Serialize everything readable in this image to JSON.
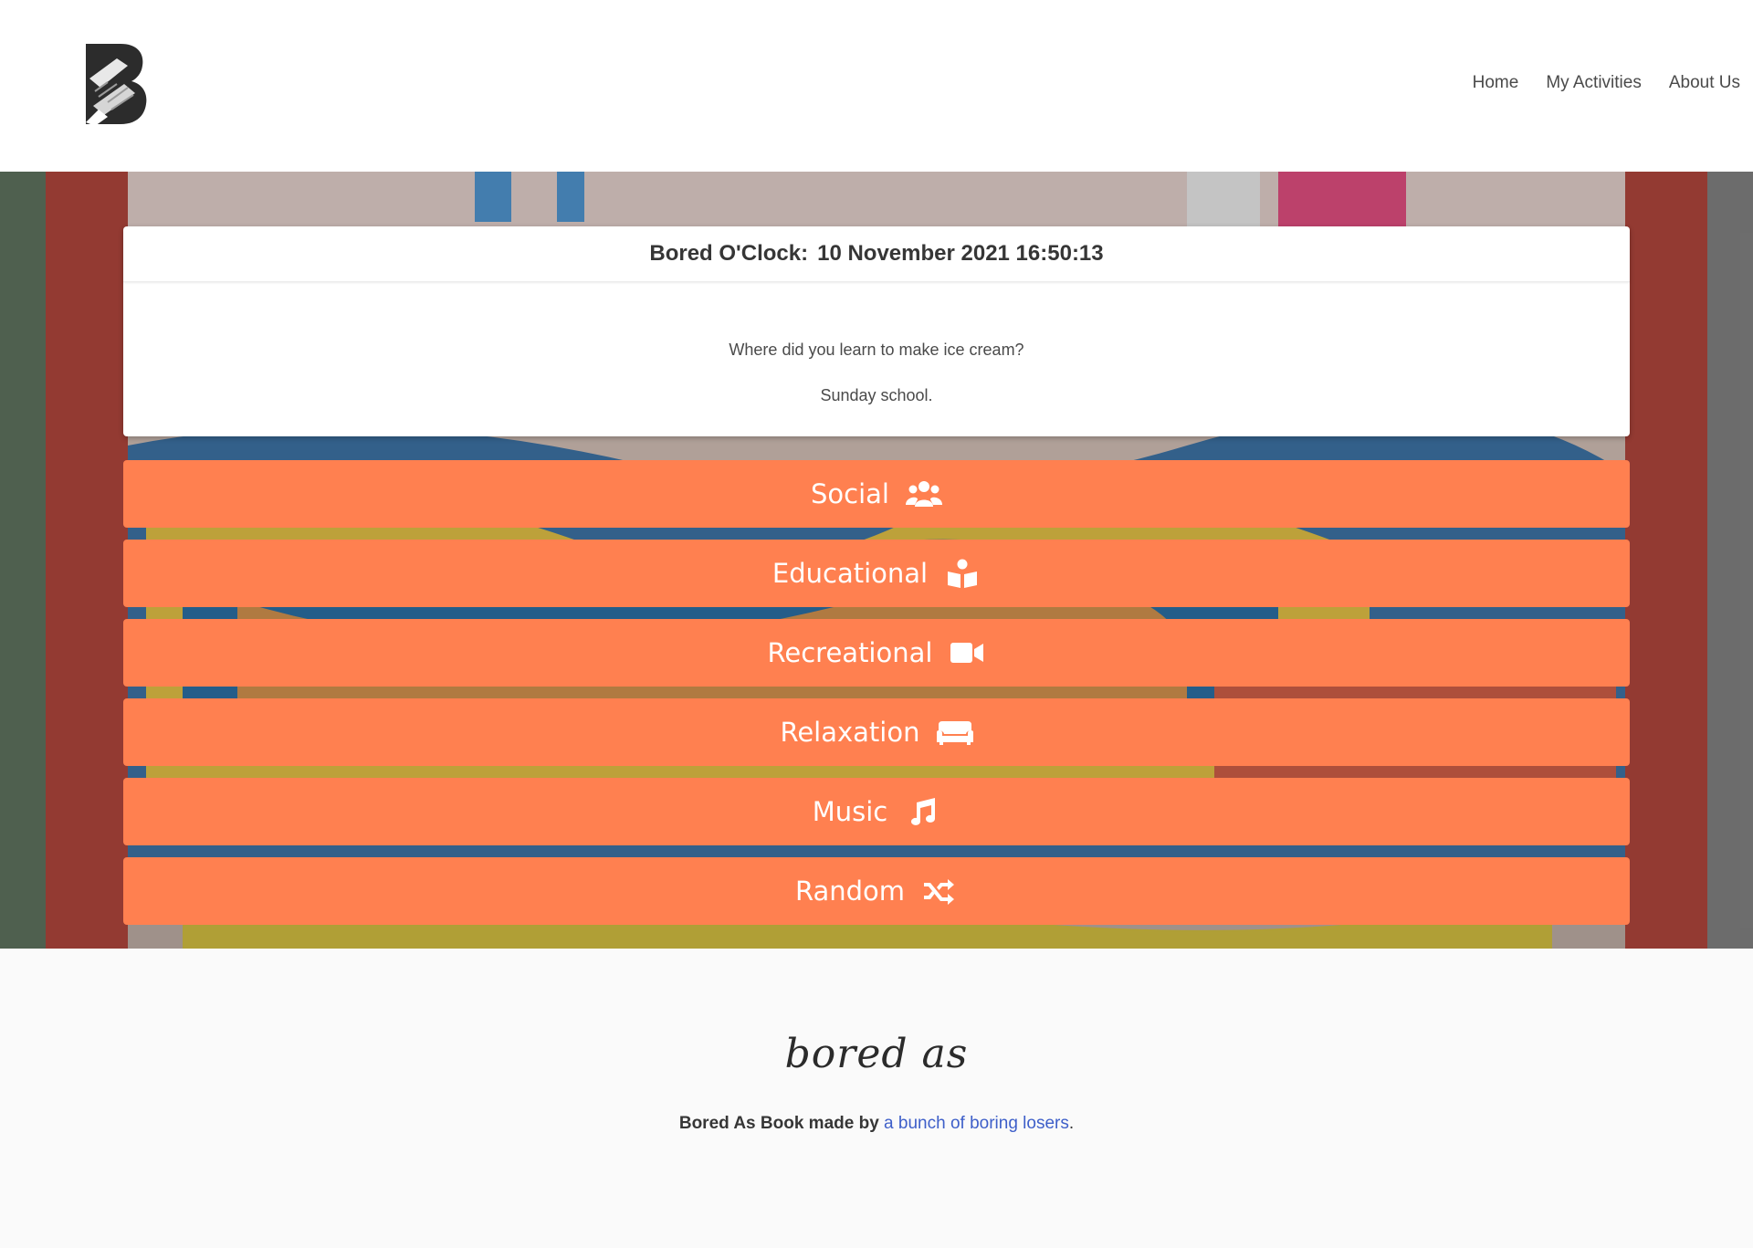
{
  "header": {
    "nav": {
      "home": "Home",
      "activities": "My Activities",
      "about": "About Us"
    }
  },
  "clock": {
    "label": "Bored O'Clock:",
    "datetime": "10 November 2021 16:50:13"
  },
  "joke": {
    "question": "Where did you learn to make ice cream?",
    "answer": "Sunday school."
  },
  "categories": {
    "social": {
      "label": "Social",
      "icon": "users-icon"
    },
    "educational": {
      "label": "Educational",
      "icon": "book-reader-icon"
    },
    "recreational": {
      "label": "Recreational",
      "icon": "video-icon"
    },
    "relaxation": {
      "label": "Relaxation",
      "icon": "couch-icon"
    },
    "music": {
      "label": "Music",
      "icon": "music-icon"
    },
    "random": {
      "label": "Random",
      "icon": "random-icon"
    }
  },
  "footer": {
    "logo_text": "bored as",
    "credit_prefix": "Bored As Book made by",
    "credit_link": "a bunch of boring losers",
    "credit_suffix": "."
  },
  "colors": {
    "button": "#ff8050",
    "link": "#3e5fc9"
  }
}
